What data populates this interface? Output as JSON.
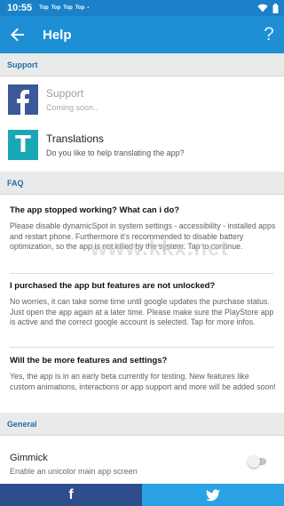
{
  "statusbar": {
    "time": "10:55",
    "notifications": [
      "Top",
      "Top",
      "Top",
      "Top"
    ],
    "dot": "•"
  },
  "appbar": {
    "title": "Help",
    "help_label": "?",
    "back_icon": "arrow-back-icon",
    "background": "#1e8fd5"
  },
  "sections": {
    "support": "Support",
    "faq": "FAQ",
    "general": "General"
  },
  "support_items": [
    {
      "name": "Support",
      "subtitle": "Coming soon..",
      "logo_letter": "f",
      "logo_color": "#3b5998",
      "enabled": false
    },
    {
      "name": "Translations",
      "subtitle": "Do you like to help translating the app?",
      "logo_letter": "T",
      "logo_color": "#1aa7b5",
      "enabled": true
    }
  ],
  "faq": [
    {
      "question": "The app stopped working? What can i do?",
      "answer": "Please disable dynamicSpot in system settings - accessibility - installed apps and restart phone. Furthermore it's recommended to disable battery optimization, so the app is not killed by the system. Tap to continue."
    },
    {
      "question": "I purchased the app but features are not unlocked?",
      "answer": "No worries, it can take some time until google updates the purchase status. Just open the app again at a later time. Please make sure the PlayStore app is active and the correct google account is selected. Tap for more infos."
    },
    {
      "question": "Will the be more features and settings?",
      "answer": "Yes, the app is in an early beta currently for testing. New features like custom animations, interactions or app support and more will be added soon!"
    }
  ],
  "general": {
    "gimmick_title": "Gimmick",
    "gimmick_subtitle": "Enable an unicolor main app screen",
    "gimmick_enabled": false
  },
  "watermark": "www.kkx.net",
  "bottombar": {
    "facebook_label": "f",
    "facebook_color": "#2e4d8c",
    "twitter_color": "#2aa2e6"
  }
}
